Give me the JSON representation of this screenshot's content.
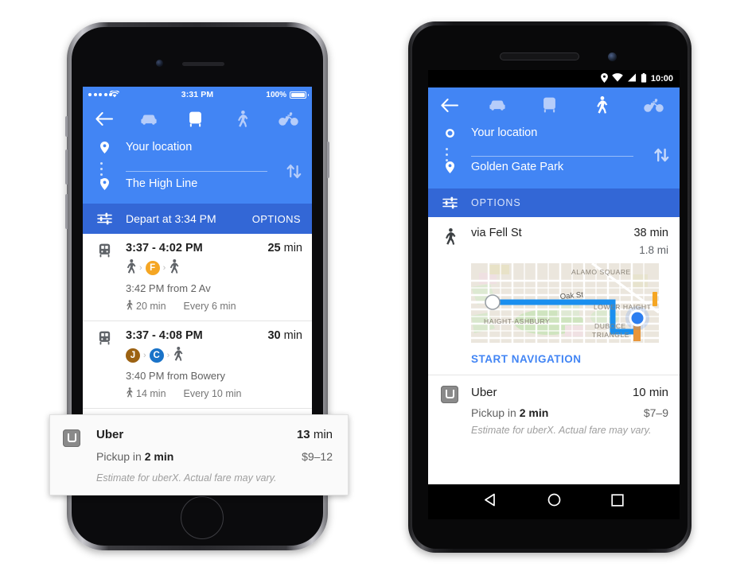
{
  "iphone": {
    "status": {
      "carrier_dots": 5,
      "time": "3:31 PM",
      "battery_text": "100%"
    },
    "header": {
      "back_icon": "arrow-left-icon",
      "modes": [
        {
          "name": "driving",
          "icon": "car-icon",
          "active": false
        },
        {
          "name": "transit",
          "icon": "train-icon",
          "active": true
        },
        {
          "name": "walking",
          "icon": "walk-icon",
          "active": false
        },
        {
          "name": "cycling",
          "icon": "bike-icon",
          "active": false
        }
      ],
      "origin": "Your location",
      "destination": "The High Line",
      "swap_icon": "swap-vertical-icon"
    },
    "options_bar": {
      "icon": "tune-icon",
      "text": "Depart at 3:34 PM",
      "action": "OPTIONS"
    },
    "results": [
      {
        "icon": "train-icon",
        "times": "3:37 - 4:02 PM",
        "duration_value": "25",
        "duration_unit": "min",
        "legs": [
          {
            "type": "walk"
          },
          {
            "type": "line",
            "label": "F",
            "color": "#f5a623"
          },
          {
            "type": "walk"
          }
        ],
        "departure": "3:42 PM from 2 Av",
        "walk_time": "20 min",
        "frequency": "Every 6 min"
      },
      {
        "icon": "train-icon",
        "times": "3:37 - 4:08 PM",
        "duration_value": "30",
        "duration_unit": "min",
        "legs": [
          {
            "type": "line",
            "label": "J",
            "color": "#9c6212"
          },
          {
            "type": "line",
            "label": "C",
            "color": "#1a73c8"
          },
          {
            "type": "walk"
          }
        ],
        "departure": "3:40 PM from Bowery",
        "walk_time": "14 min",
        "frequency": "Every 10 min"
      }
    ],
    "uber_card": {
      "icon": "uber-logo-icon",
      "title": "Uber",
      "eta_value": "13",
      "eta_unit": "min",
      "pickup_prefix": "Pickup in ",
      "pickup_value": "2 min",
      "price": "$9–12",
      "note": "Estimate for uberX. Actual fare may vary."
    }
  },
  "android": {
    "status": {
      "icons": [
        "location-icon",
        "wifi-icon",
        "signal-icon",
        "battery-icon"
      ],
      "time": "10:00"
    },
    "header": {
      "back_icon": "arrow-left-icon",
      "modes": [
        {
          "name": "driving",
          "icon": "car-icon",
          "active": false
        },
        {
          "name": "transit",
          "icon": "train-icon",
          "active": false
        },
        {
          "name": "walking",
          "icon": "walk-icon",
          "active": true
        },
        {
          "name": "cycling",
          "icon": "bike-icon",
          "active": false
        }
      ],
      "origin": "Your location",
      "destination": "Golden Gate Park",
      "swap_icon": "swap-vertical-icon"
    },
    "options_bar": {
      "icon": "tune-icon",
      "text": "OPTIONS"
    },
    "walk_result": {
      "icon": "walk-icon",
      "via": "via Fell St",
      "duration": "38 min",
      "distance": "1.8 mi",
      "start_navigation": "START NAVIGATION",
      "map_labels": [
        "ALAMO SQUARE",
        "Oak St",
        "LOWER HAIGHT",
        "HAIGHT-ASHBURY",
        "DUBOCE",
        "TRIANGLE"
      ]
    },
    "uber_card": {
      "icon": "uber-logo-icon",
      "title": "Uber",
      "eta": "10 min",
      "pickup_prefix": "Pickup in ",
      "pickup_value": "2 min",
      "price": "$7–9",
      "note": "Estimate for uberX. Actual fare may vary."
    },
    "navbar": [
      {
        "name": "back",
        "icon": "triangle-back-icon"
      },
      {
        "name": "home",
        "icon": "circle-home-icon"
      },
      {
        "name": "recents",
        "icon": "square-recents-icon"
      }
    ]
  },
  "colors": {
    "brand_blue": "#4285f4",
    "options_blue": "#3367d6",
    "route_blue": "#1a8fef",
    "text_primary": "#212121",
    "text_secondary": "#616161",
    "text_tertiary": "#9e9e9e"
  }
}
